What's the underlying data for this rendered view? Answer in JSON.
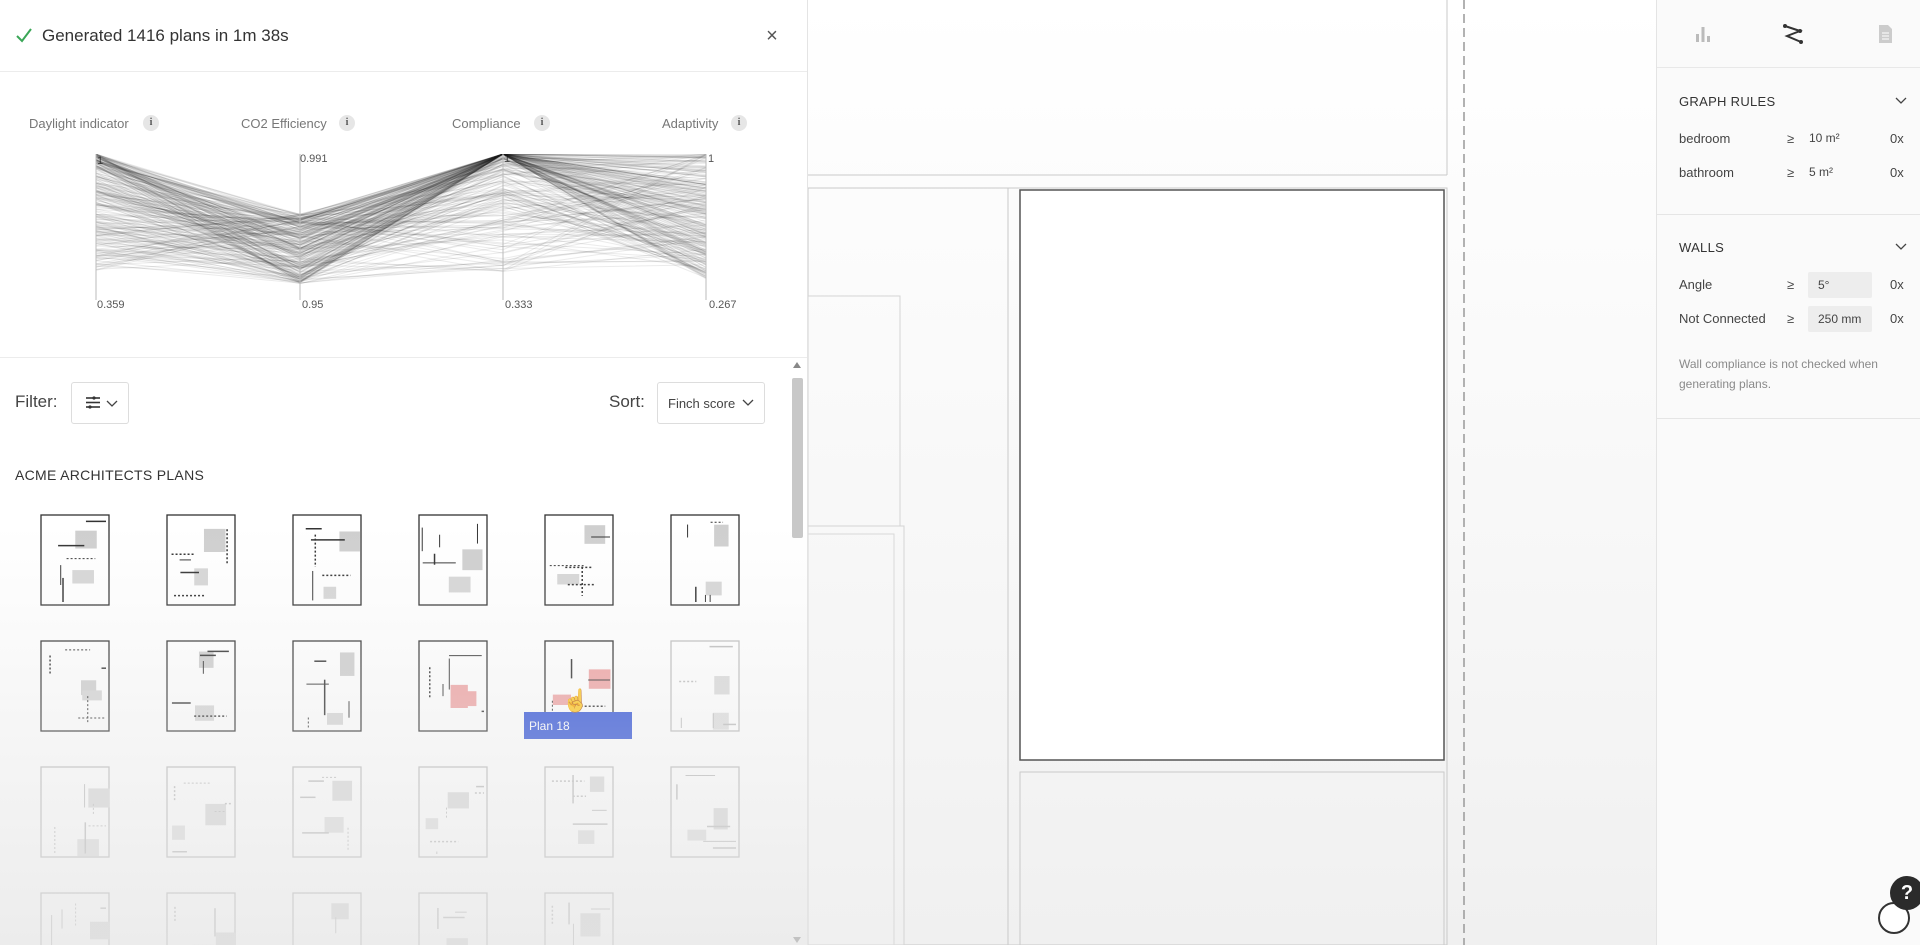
{
  "generation": {
    "title": "Generated 1416 plans in 1m 38s",
    "close_label": "×"
  },
  "metrics": {
    "axes": [
      {
        "label": "Daylight indicator",
        "max": "1",
        "min": "0.359"
      },
      {
        "label": "CO2 Efficiency",
        "max": "0.991",
        "min": "0.95"
      },
      {
        "label": "Compliance",
        "max": "1",
        "min": "0.333"
      },
      {
        "label": "Adaptivity",
        "max": "1",
        "min": "0.267"
      }
    ],
    "info_label": "i"
  },
  "filter": {
    "label": "Filter:"
  },
  "sort": {
    "label": "Sort:",
    "selected": "Finch score"
  },
  "plans": {
    "section_title": "ACME ARCHITECTS PLANS",
    "hover_label": "Plan 18"
  },
  "right_panel": {
    "graph_rules": {
      "title": "GRAPH RULES",
      "rows": [
        {
          "label": "bedroom",
          "op": "≥",
          "value": "10 m²",
          "count": "0x"
        },
        {
          "label": "bathroom",
          "op": "≥",
          "value": "5 m²",
          "count": "0x"
        }
      ]
    },
    "walls": {
      "title": "WALLS",
      "rows": [
        {
          "label": "Angle",
          "op": "≥",
          "value": "5°",
          "count": "0x"
        },
        {
          "label": "Not Connected",
          "op": "≥",
          "value": "250 mm",
          "count": "0x"
        }
      ],
      "note": "Wall compliance is not checked when generating plans."
    }
  },
  "help": {
    "label": "?"
  },
  "colors": {
    "accent": "#3a5ad9",
    "check": "#3aa657",
    "highlight": "#f0a7a7"
  }
}
